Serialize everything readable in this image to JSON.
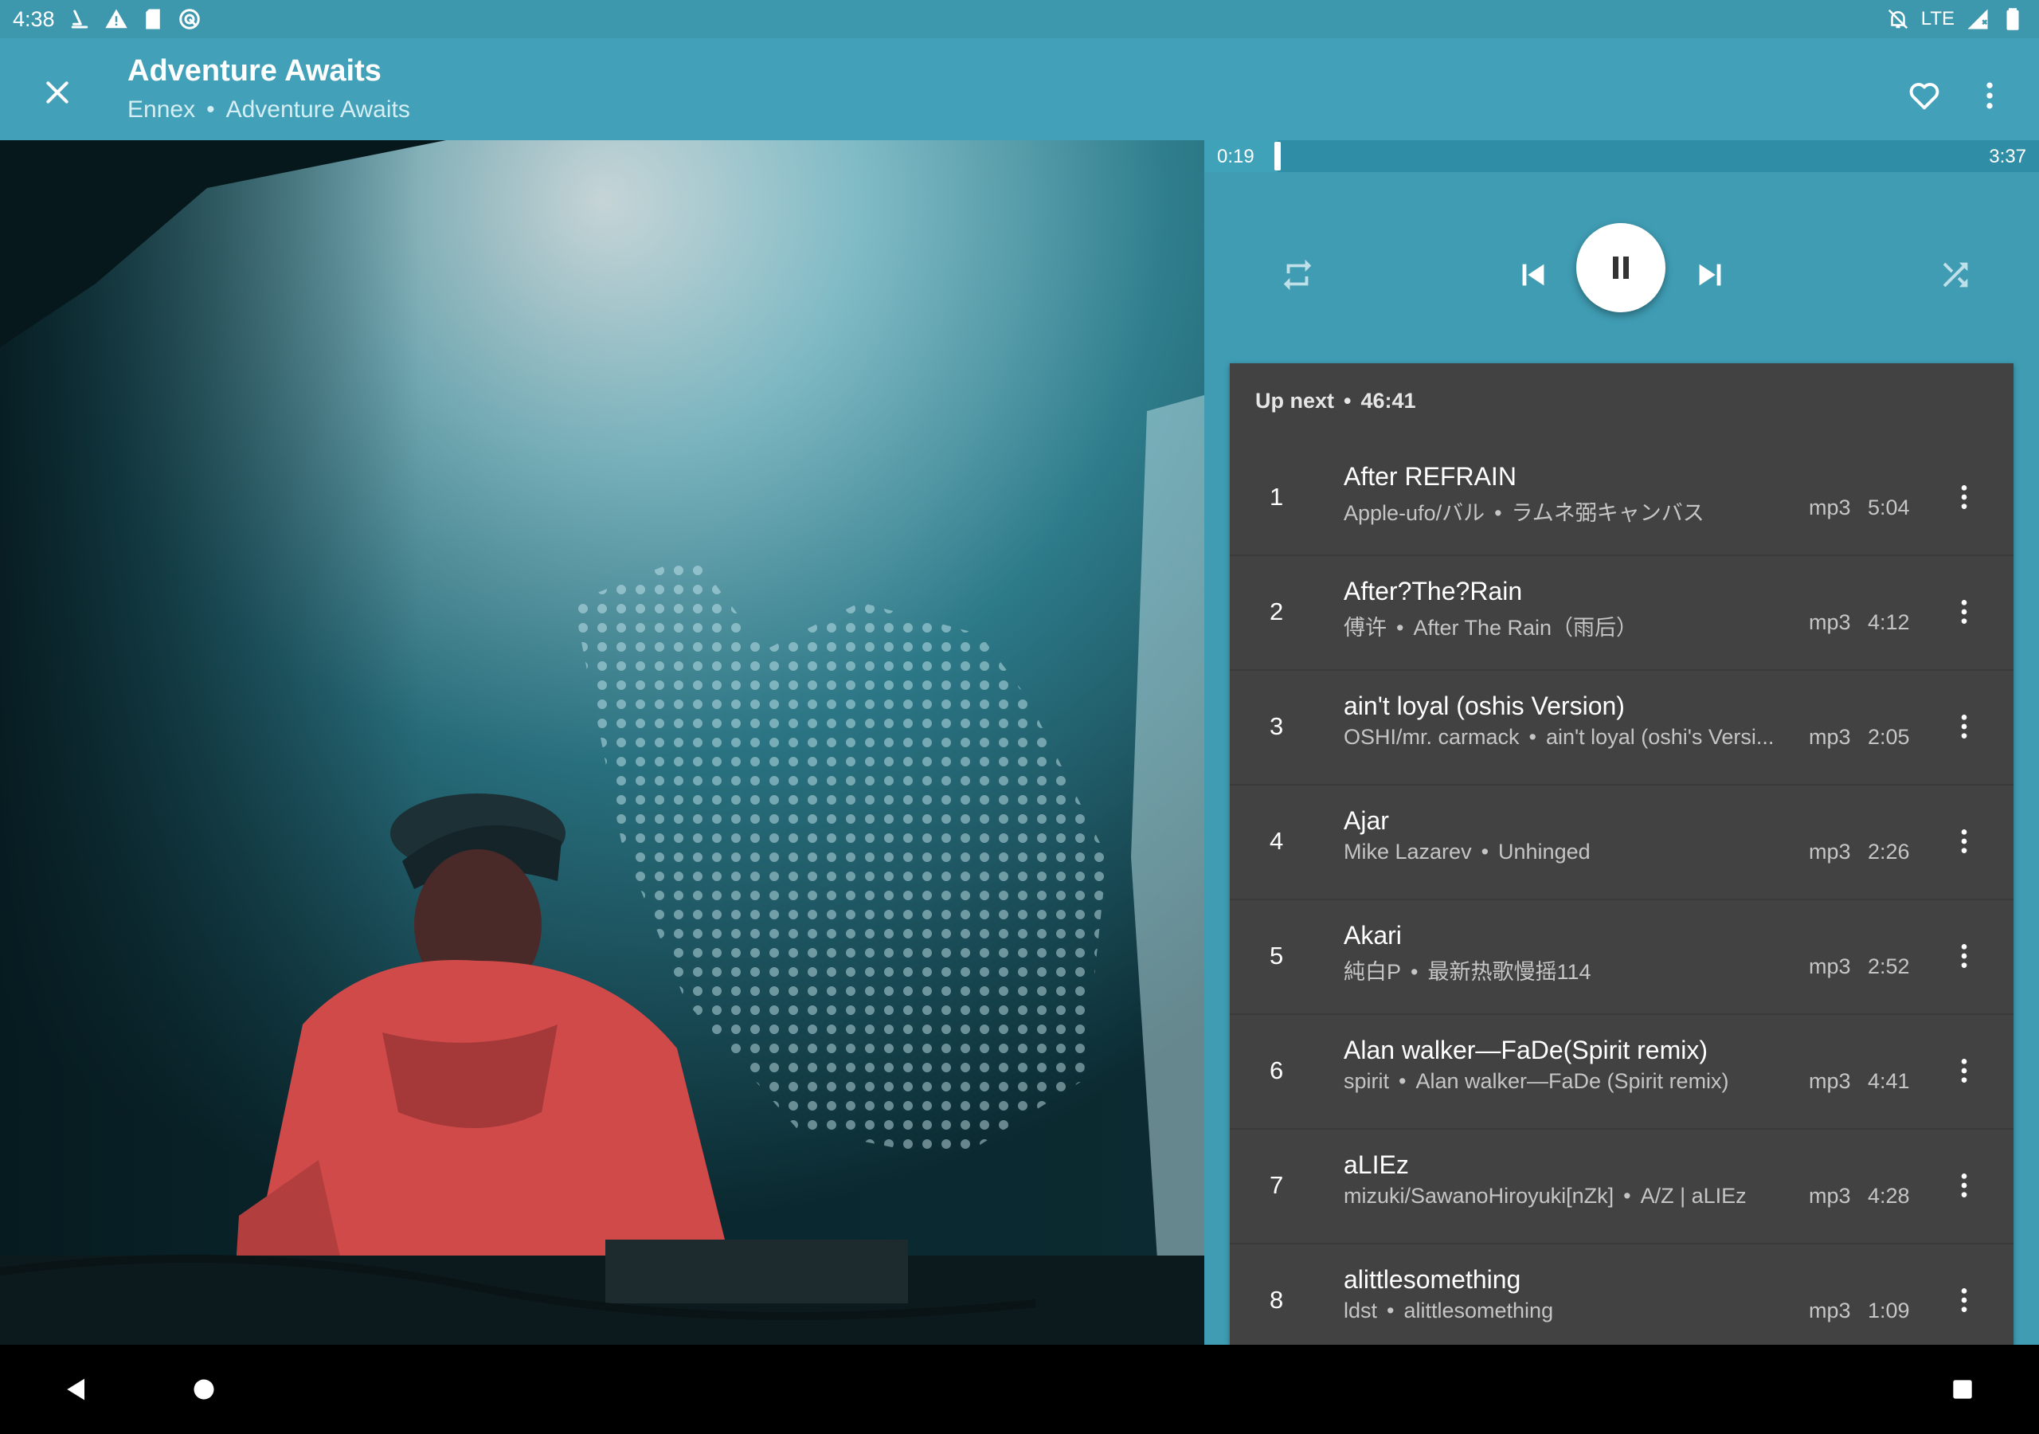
{
  "status_bar": {
    "time": "4:38",
    "left_icons": [
      "download-icon",
      "warning-icon",
      "sd-card-icon",
      "sync-icon"
    ],
    "network": "LTE",
    "right_icons": [
      "no-alarm-icon",
      "signal-icon",
      "battery-icon"
    ]
  },
  "header": {
    "title": "Adventure Awaits",
    "artist": "Ennex",
    "album": "Adventure Awaits",
    "separator": "•"
  },
  "player": {
    "elapsed": "0:19",
    "duration": "3:37",
    "progress_fraction": 0.088,
    "state": "playing"
  },
  "queue": {
    "label": "Up next",
    "separator": "•",
    "total": "46:41",
    "items": [
      {
        "num": "1",
        "title": "After REFRAIN",
        "artist": "Apple-ufo/バル",
        "album": "ラムネ弼キャンバス",
        "format": "mp3",
        "duration": "5:04"
      },
      {
        "num": "2",
        "title": "After?The?Rain",
        "artist": "傅许",
        "album": "After The Rain（雨后）",
        "format": "mp3",
        "duration": "4:12"
      },
      {
        "num": "3",
        "title": "ain't loyal (oshis Version)",
        "artist": "OSHI/mr. carmack",
        "album": "ain't loyal (oshi's Versi...",
        "format": "mp3",
        "duration": "2:05"
      },
      {
        "num": "4",
        "title": "Ajar",
        "artist": "Mike Lazarev",
        "album": "Unhinged",
        "format": "mp3",
        "duration": "2:26"
      },
      {
        "num": "5",
        "title": "Akari",
        "artist": "純白P",
        "album": "最新热歌慢摇114",
        "format": "mp3",
        "duration": "2:52"
      },
      {
        "num": "6",
        "title": "Alan walker—FaDe(Spirit remix)",
        "artist": "spirit",
        "album": "Alan walker—FaDe (Spirit remix)",
        "format": "mp3",
        "duration": "4:41"
      },
      {
        "num": "7",
        "title": "aLIEz",
        "artist": "mizuki/SawanoHiroyuki[nZk]",
        "album": "A/Z | aLIEz",
        "format": "mp3",
        "duration": "4:28"
      },
      {
        "num": "8",
        "title": "alittlesomething",
        "artist": "ldst",
        "album": "alittlesomething",
        "format": "mp3",
        "duration": "1:09"
      }
    ]
  },
  "colors": {
    "status_bar": "#3d97ad",
    "app_bar": "#42a1b9",
    "panel": "#3f9cb3",
    "queue_card": "#424242"
  }
}
